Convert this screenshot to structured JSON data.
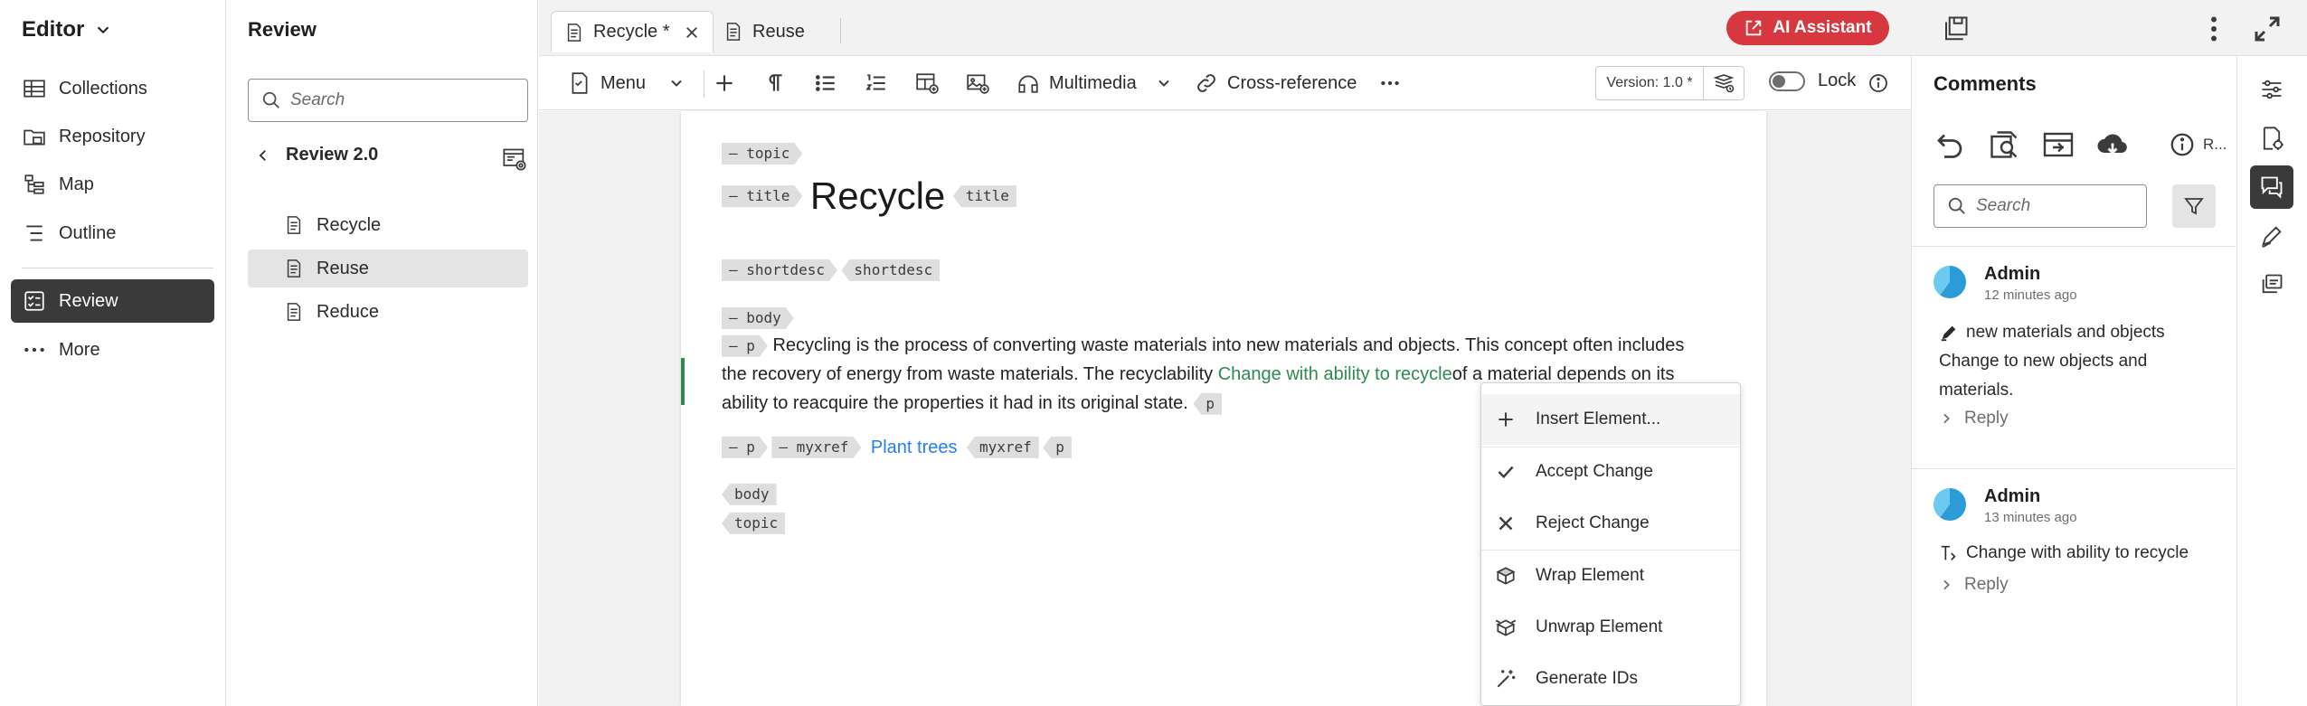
{
  "leftnav": {
    "app_title": "Editor",
    "items": [
      {
        "label": "Collections",
        "icon": "grid-icon"
      },
      {
        "label": "Repository",
        "icon": "folder-icon"
      },
      {
        "label": "Map",
        "icon": "map-icon"
      },
      {
        "label": "Outline",
        "icon": "outline-icon"
      },
      {
        "label": "Review",
        "icon": "review-icon",
        "active": true
      },
      {
        "label": "More",
        "icon": "more-dots-icon"
      }
    ]
  },
  "review_panel": {
    "title": "Review",
    "search_placeholder": "Search",
    "back_label": "Review 2.0",
    "files": [
      {
        "label": "Recycle"
      },
      {
        "label": "Reuse",
        "active": true
      },
      {
        "label": "Reduce"
      }
    ]
  },
  "tabs": [
    {
      "label": "Recycle *",
      "active": true
    },
    {
      "label": "Reuse"
    }
  ],
  "header": {
    "ai_label": "AI Assistant",
    "accent_color": "#d7373f"
  },
  "toolbar": {
    "menu_label": "Menu",
    "multimedia_label": "Multimedia",
    "crossref_label": "Cross-reference",
    "version_label": "Version: 1.0 *",
    "lock_label": "Lock"
  },
  "document": {
    "topic_tag": "topic",
    "title_tag": "title",
    "title_text": "Recycle",
    "shortdesc_tag": "shortdesc",
    "body_tag": "body",
    "p_tag": "p",
    "para1_text": "Recycling is the process of converting waste materials into new materials and objects. This concept often includes the recovery of energy from waste materials. The recyclability ",
    "para1_change": "Change with ability to recycle",
    "para1_tail": "of a material depends on its ability to reacquire the properties it had in its original state.",
    "myxref_tag": "myxref",
    "link_text": "Plant trees",
    "change_color": "#2d8a4f"
  },
  "context_menu": {
    "items": [
      {
        "label": "Insert Element...",
        "icon": "plus-icon"
      },
      {
        "label": "Accept Change",
        "icon": "checkmark-icon"
      },
      {
        "label": "Reject Change",
        "icon": "x-icon"
      },
      {
        "label": "Wrap Element",
        "icon": "wrap-element-icon"
      },
      {
        "label": "Unwrap Element",
        "icon": "unwrap-element-icon"
      },
      {
        "label": "Generate IDs",
        "icon": "magic-wand-icon"
      }
    ]
  },
  "comments": {
    "title": "Comments",
    "tool_label": "R...",
    "search_placeholder": "Search",
    "items": [
      {
        "author": "Admin",
        "time": "12 minutes ago",
        "text": "new materials and objects Change to new objects and materials.",
        "reply_label": "Reply",
        "icon": "pencil-edit-icon"
      },
      {
        "author": "Admin",
        "time": "13 minutes ago",
        "text": "Change with ability to recycle",
        "reply_label": "Reply",
        "icon": "text-change-icon"
      }
    ]
  }
}
